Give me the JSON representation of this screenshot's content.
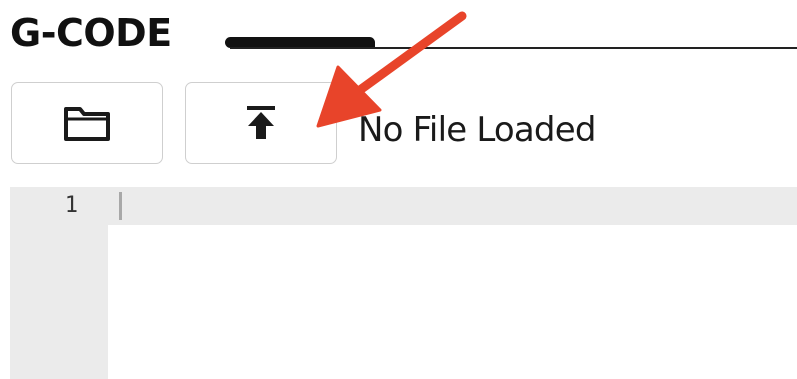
{
  "panel": {
    "title": "G-CODE"
  },
  "toolbar": {
    "open_icon": "folder-icon",
    "upload_icon": "upload-icon"
  },
  "status": {
    "text": "No File Loaded"
  },
  "editor": {
    "line_numbers": [
      "1"
    ]
  },
  "annotation": {
    "arrow_color": "#e8442a"
  }
}
